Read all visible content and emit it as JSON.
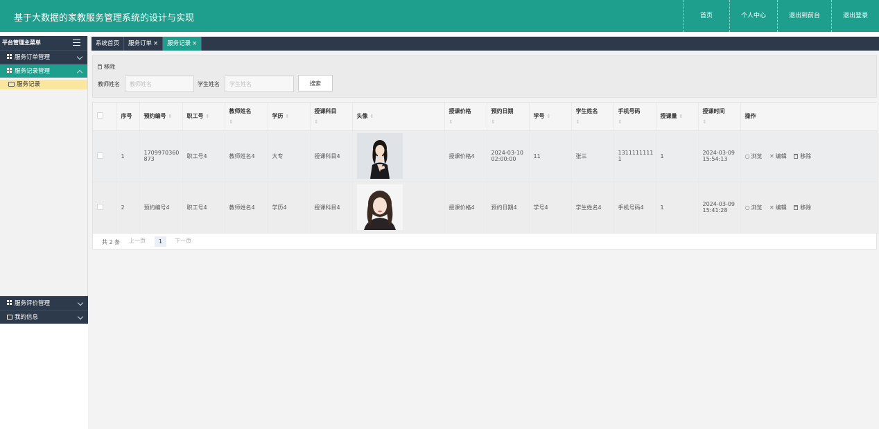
{
  "header": {
    "title": "基于大数据的家教服务管理系统的设计与实现",
    "nav": [
      "首页",
      "个人中心",
      "退出到前台",
      "退出登录"
    ]
  },
  "sidebar": {
    "heading": "平台管理主菜单",
    "groups": [
      {
        "label": "服务订单管理"
      },
      {
        "label": "服务记录管理"
      }
    ],
    "sub_item": "服务记录",
    "bottom_groups": [
      {
        "label": "服务评价管理"
      },
      {
        "label": "我的信息"
      }
    ]
  },
  "tabs": [
    "系统首页",
    "服务订单",
    "服务记录"
  ],
  "tab_close": "×",
  "toolbar": {
    "remove": "移除",
    "teacher_label": "教师姓名",
    "teacher_placeholder": "教师姓名",
    "student_label": "学生姓名",
    "student_placeholder": "学生姓名",
    "search_button": "搜索"
  },
  "table": {
    "columns": [
      "序号",
      "预约编号",
      "职工号",
      "教师姓名",
      "学历",
      "授课科目",
      "头像",
      "授课价格",
      "预约日期",
      "学号",
      "学生姓名",
      "手机号码",
      "授课量",
      "授课时间",
      "操作"
    ],
    "sort_glyph": "⇕",
    "rows": [
      {
        "index": "1",
        "booking_no": "1709970360873",
        "staff_no": "职工号4",
        "teacher": "教师姓名4",
        "education": "大专",
        "subject": "授课科目4",
        "price": "授课价格4",
        "date": "2024-03-10 02:00:00",
        "student_no": "11",
        "student": "张三",
        "phone": "13111111111",
        "amount": "1",
        "time": "2024-03-09 15:54:13"
      },
      {
        "index": "2",
        "booking_no": "预约编号4",
        "staff_no": "职工号4",
        "teacher": "教师姓名4",
        "education": "学历4",
        "subject": "授课科目4",
        "price": "授课价格4",
        "date": "预约日期4",
        "student_no": "学号4",
        "student": "学生姓名4",
        "phone": "手机号码4",
        "amount": "1",
        "time": "2024-03-09 15:41:28"
      }
    ],
    "actions": {
      "view": "浏览",
      "edit": "编辑",
      "remove": "移除"
    }
  },
  "pager": {
    "total": "共 2 条",
    "prev": "上一页",
    "page": "1",
    "next": "下一页"
  },
  "colors": {
    "header": "#1e9e8c",
    "dark": "#2d3a4b",
    "highlight": "#fbe6a0"
  }
}
